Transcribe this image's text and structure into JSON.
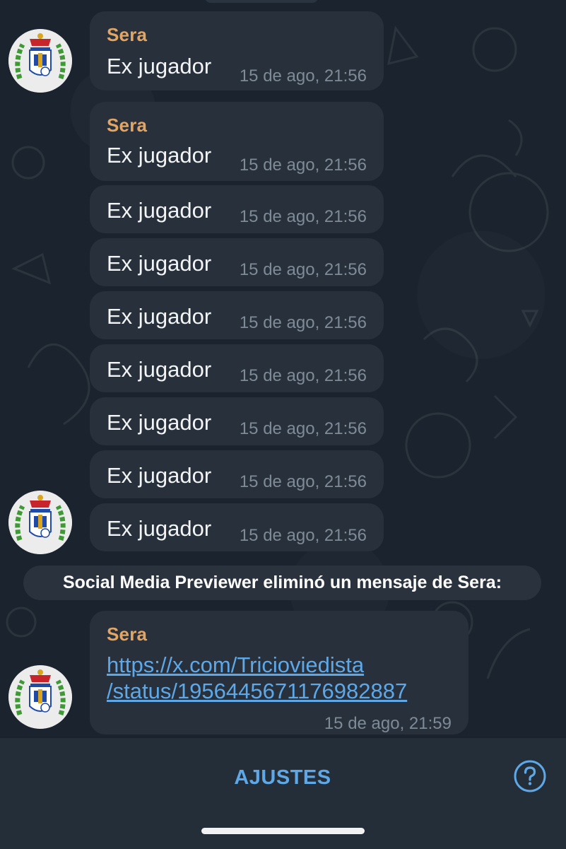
{
  "sender_name": "Sera",
  "messages": [
    {
      "text": "Ex jugador",
      "time": "15 de ago, 21:56"
    },
    {
      "text": "Ex jugador",
      "time": "15 de ago, 21:56"
    },
    {
      "text": "Ex jugador",
      "time": "15 de ago, 21:56"
    },
    {
      "text": "Ex jugador",
      "time": "15 de ago, 21:56"
    },
    {
      "text": "Ex jugador",
      "time": "15 de ago, 21:56"
    },
    {
      "text": "Ex jugador",
      "time": "15 de ago, 21:56"
    },
    {
      "text": "Ex jugador",
      "time": "15 de ago, 21:56"
    },
    {
      "text": "Ex jugador",
      "time": "15 de ago, 21:56"
    },
    {
      "text": "Ex jugador",
      "time": "15 de ago, 21:56"
    }
  ],
  "service_message": "Social Media Previewer eliminó un mensaje de Sera:",
  "link_message": {
    "sender": "Sera",
    "link_line1": "https://x.com/Tricioviedista",
    "link_line2": "/status/1956445671176982887",
    "time": "15 de ago, 21:59"
  },
  "bottom_bar": {
    "settings_label": "AJUSTES",
    "help_icon": "help-circle-icon"
  },
  "colors": {
    "background": "#1b232e",
    "bubble": "#27303b",
    "sender_name": "#e2a563",
    "link": "#5fa8e8",
    "accent": "#5fa8e8"
  },
  "avatar_icon": "club-crest-avatar"
}
